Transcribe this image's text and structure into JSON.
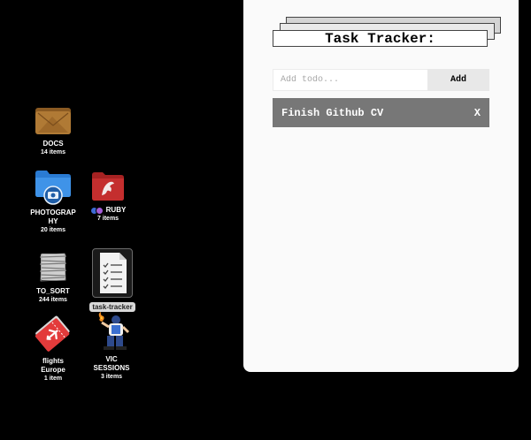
{
  "desktop": {
    "icons": [
      {
        "name": "DOCS",
        "count": "14 items"
      },
      {
        "name": "PHOTOGRAP\nHY",
        "count": "20 items"
      },
      {
        "name": "RUBY",
        "count": "7 items"
      },
      {
        "name": "TO_SORT",
        "count": "244 items"
      },
      {
        "name": "task-tracker",
        "count": ""
      },
      {
        "name": "flights\nEurope",
        "count": "1 item"
      },
      {
        "name": "VIC\nSESSIONS",
        "count": "3 items"
      }
    ],
    "ruby_tags": [
      "#3d6bd6",
      "#a45cd8"
    ]
  },
  "app": {
    "title": "Task Tracker:",
    "input": {
      "placeholder": "Add todo...",
      "value": ""
    },
    "add_label": "Add",
    "todos": [
      {
        "text": "Finish Github CV",
        "delete_label": "X"
      }
    ]
  }
}
